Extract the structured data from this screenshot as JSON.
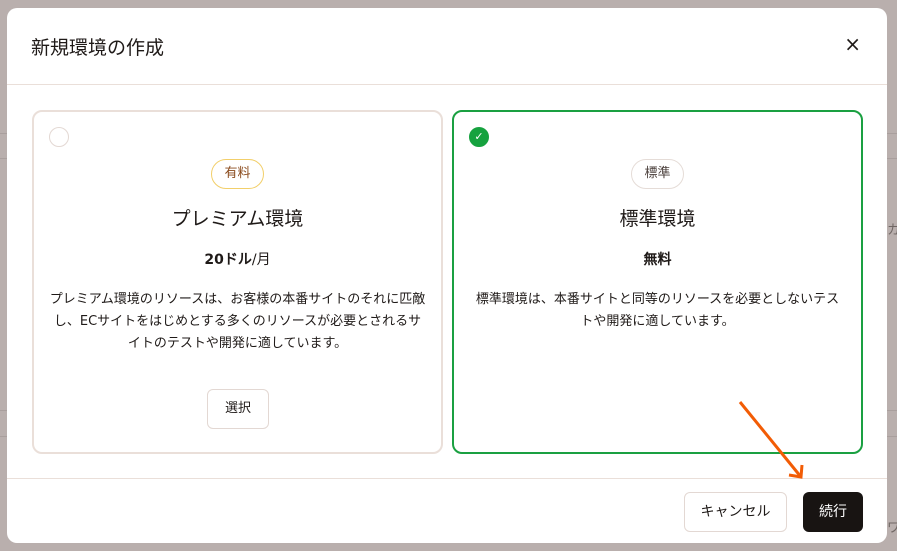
{
  "background": {
    "fragments": [
      "カ",
      "ワ"
    ]
  },
  "modal": {
    "title": "新規環境の作成",
    "close_label": "×",
    "options": [
      {
        "badge": "有料",
        "name": "プレミアム環境",
        "price_amount": "20ドル",
        "price_unit": "/月",
        "description": "プレミアム環境のリソースは、お客様の本番サイトのそれに匹敵し、ECサイトをはじめとする多くのリソースが必要とされるサイトのテストや開発に適しています。",
        "select_label": "選択",
        "selected": false
      },
      {
        "badge": "標準",
        "name": "標準環境",
        "price_amount": "無料",
        "description": "標準環境は、本番サイトと同等のリソースを必要としないテストや開発に適しています。",
        "selected": true
      }
    ],
    "footer": {
      "cancel_label": "キャンセル",
      "continue_label": "続行"
    }
  },
  "colors": {
    "selected": "#1aa041",
    "annotation_arrow": "#f25c05",
    "primary_button": "#181412"
  }
}
